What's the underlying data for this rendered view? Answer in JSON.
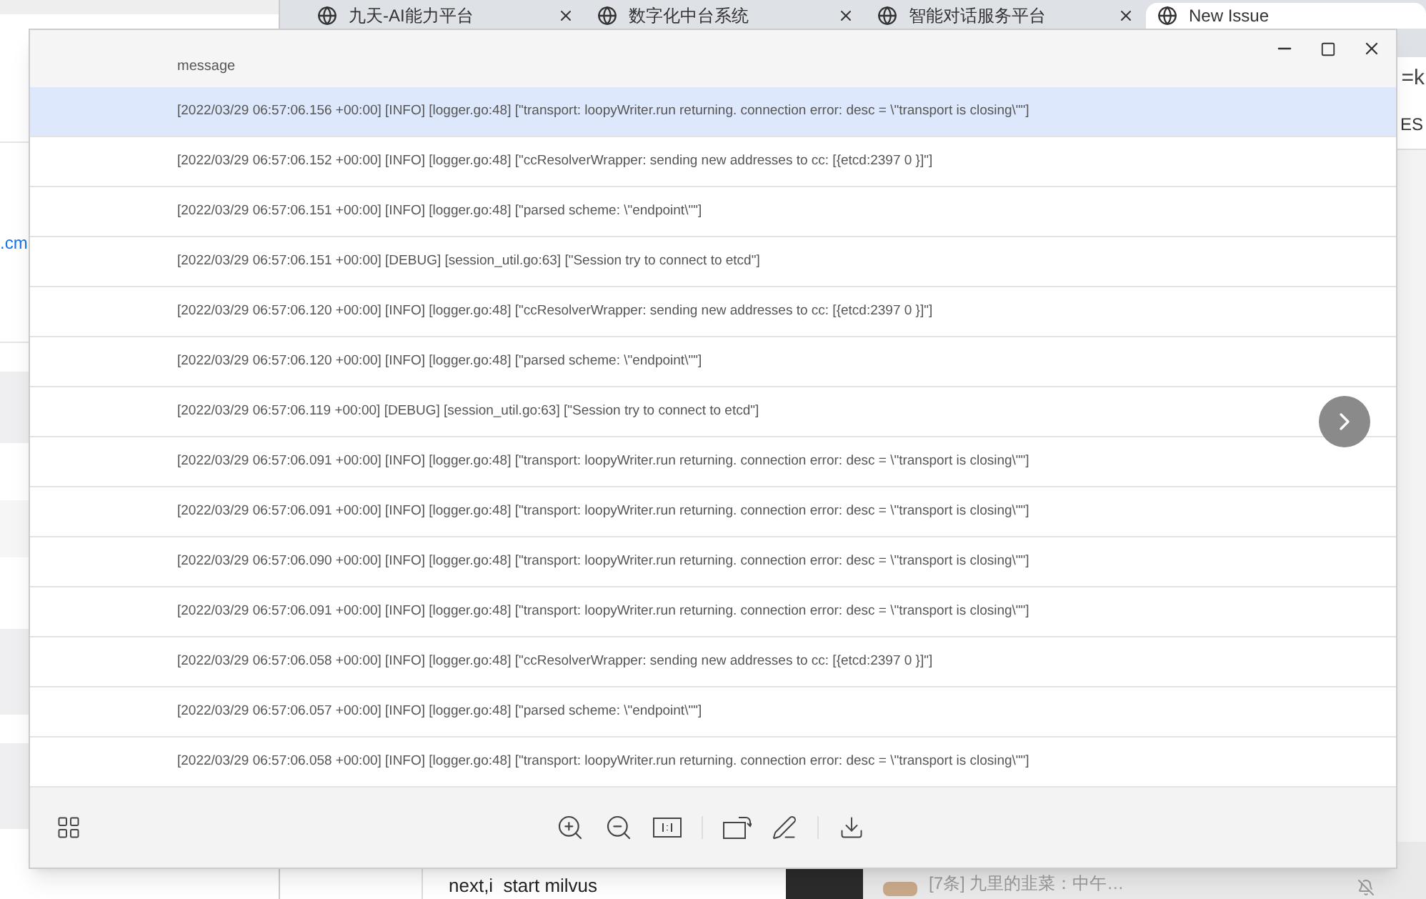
{
  "browser": {
    "tabs": [
      {
        "title": "九天-AI能力平台",
        "selected": false
      },
      {
        "title": "数字化中台系统",
        "selected": false
      },
      {
        "title": "智能对话服务平台",
        "selected": false
      },
      {
        "title": "New Issue",
        "selected": true
      }
    ],
    "address_fragment": "=k",
    "page_fragment": "ES",
    "left_link_fragment": ".cm",
    "editor_line": "next,i  start milvus",
    "notification": "[7条] 九里的韭菜：中午…"
  },
  "viewer": {
    "header": "message",
    "rows": [
      {
        "text": "[2022/03/29 06:57:06.156 +00:00] [INFO] [logger.go:48] [\"transport: loopyWriter.run returning. connection error: desc = \\\"transport is closing\\\"\"]",
        "selected": true
      },
      {
        "text": "[2022/03/29 06:57:06.152 +00:00] [INFO] [logger.go:48] [\"ccResolverWrapper: sending new addresses to cc: [{etcd:2397 0 }]\"]",
        "selected": false
      },
      {
        "text": "[2022/03/29 06:57:06.151 +00:00] [INFO] [logger.go:48] [\"parsed scheme: \\\"endpoint\\\"\"]",
        "selected": false
      },
      {
        "text": "[2022/03/29 06:57:06.151 +00:00] [DEBUG] [session_util.go:63] [\"Session try to connect to etcd\"]",
        "selected": false
      },
      {
        "text": "[2022/03/29 06:57:06.120 +00:00] [INFO] [logger.go:48] [\"ccResolverWrapper: sending new addresses to cc: [{etcd:2397 0 }]\"]",
        "selected": false
      },
      {
        "text": "[2022/03/29 06:57:06.120 +00:00] [INFO] [logger.go:48] [\"parsed scheme: \\\"endpoint\\\"\"]",
        "selected": false
      },
      {
        "text": "[2022/03/29 06:57:06.119 +00:00] [DEBUG] [session_util.go:63] [\"Session try to connect to etcd\"]",
        "selected": false
      },
      {
        "text": "[2022/03/29 06:57:06.091 +00:00] [INFO] [logger.go:48] [\"transport: loopyWriter.run returning. connection error: desc = \\\"transport is closing\\\"\"]",
        "selected": false
      },
      {
        "text": "[2022/03/29 06:57:06.091 +00:00] [INFO] [logger.go:48] [\"transport: loopyWriter.run returning. connection error: desc = \\\"transport is closing\\\"\"]",
        "selected": false
      },
      {
        "text": "[2022/03/29 06:57:06.090 +00:00] [INFO] [logger.go:48] [\"transport: loopyWriter.run returning. connection error: desc = \\\"transport is closing\\\"\"]",
        "selected": false
      },
      {
        "text": "[2022/03/29 06:57:06.091 +00:00] [INFO] [logger.go:48] [\"transport: loopyWriter.run returning. connection error: desc = \\\"transport is closing\\\"\"]",
        "selected": false
      },
      {
        "text": "[2022/03/29 06:57:06.058 +00:00] [INFO] [logger.go:48] [\"ccResolverWrapper: sending new addresses to cc: [{etcd:2397 0 }]\"]",
        "selected": false
      },
      {
        "text": "[2022/03/29 06:57:06.057 +00:00] [INFO] [logger.go:48] [\"parsed scheme: \\\"endpoint\\\"\"]",
        "selected": false
      },
      {
        "text": "[2022/03/29 06:57:06.058 +00:00] [INFO] [logger.go:48] [\"transport: loopyWriter.run returning. connection error: desc = \\\"transport is closing\\\"\"]",
        "selected": false
      }
    ]
  }
}
